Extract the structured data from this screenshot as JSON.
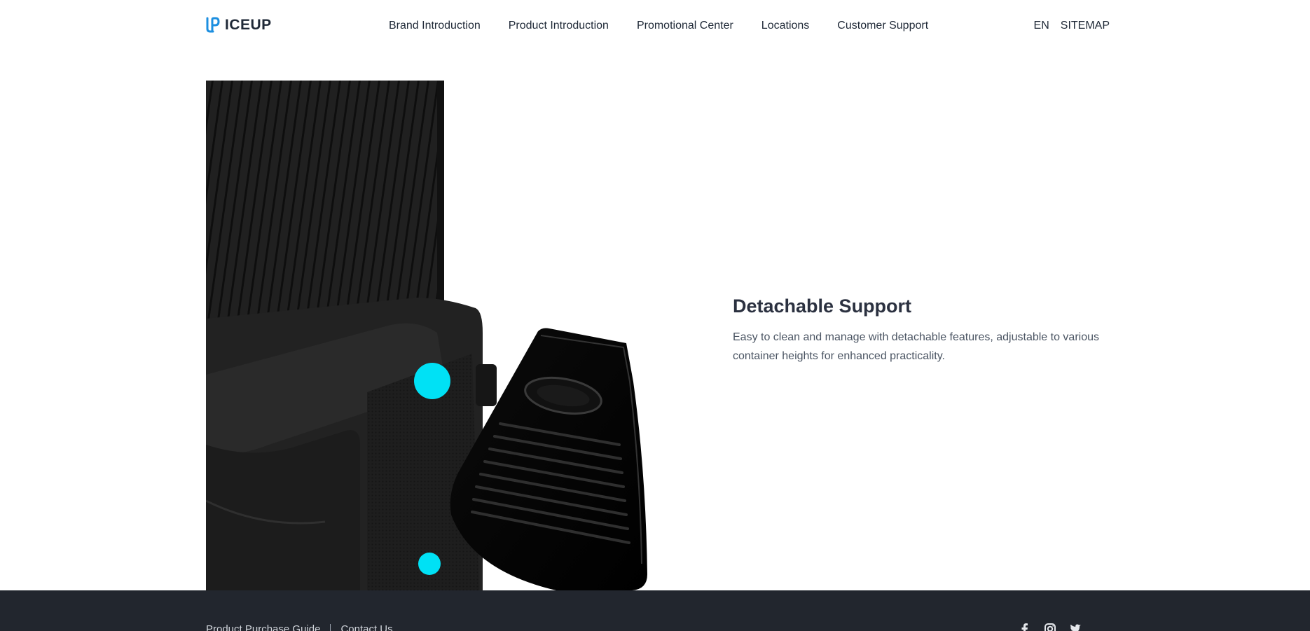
{
  "header": {
    "logo_text": "ICEUP",
    "nav": [
      {
        "label": "Brand Introduction"
      },
      {
        "label": "Product Introduction"
      },
      {
        "label": "Promotional Center"
      },
      {
        "label": "Locations"
      },
      {
        "label": "Customer Support"
      }
    ],
    "language": "EN",
    "sitemap": "SITEMAP"
  },
  "feature": {
    "title": "Detachable Support",
    "description": "Easy to clean and manage with detachable features, adjustable to various container heights for enhanced practicality."
  },
  "footer": {
    "links": [
      {
        "label": "Product Purchase Guide"
      },
      {
        "label": "Contact Us"
      }
    ],
    "social_icons": [
      "facebook-icon",
      "instagram-icon",
      "twitter-icon"
    ]
  },
  "colors": {
    "accent_hotspot": "#00e1f5",
    "logo_blue": "#1d8fe0",
    "footer_bg": "#22262e"
  }
}
